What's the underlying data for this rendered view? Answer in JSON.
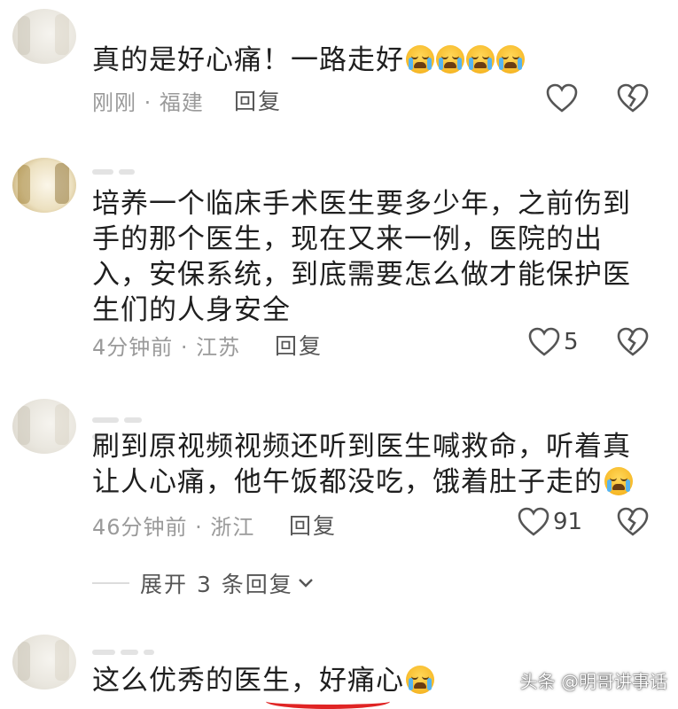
{
  "comments": [
    {
      "text": "真的是好心痛！一路走好",
      "emoji_count": 4,
      "time_location": "刚刚 · 福建",
      "reply_label": "回复",
      "like_count": ""
    },
    {
      "text": "培养一个临床手术医生要多少年，之前伤到手的那个医生，现在又来一例，医院的出入，安保系统，到底需要怎么做才能保护医生们的人身安全",
      "time_location": "4分钟前 · 江苏",
      "reply_label": "回复",
      "like_count": "5"
    },
    {
      "text": "刷到原视频视频还听到医生喊救命，听着真让人心痛，他午饭都没吃，饿着肚子走的",
      "emoji_count": 1,
      "time_location": "46分钟前 · 浙江",
      "reply_label": "回复",
      "like_count": "91"
    },
    {
      "text": "这么优秀的医生，好痛心",
      "emoji_count": 1
    }
  ],
  "expand_replies": "展开 3 条回复",
  "watermark": "头条 @明哥讲事话",
  "colors": {
    "text": "#1f1f1f",
    "meta": "#9a9a9a",
    "highlight_underline": "#e02424"
  }
}
